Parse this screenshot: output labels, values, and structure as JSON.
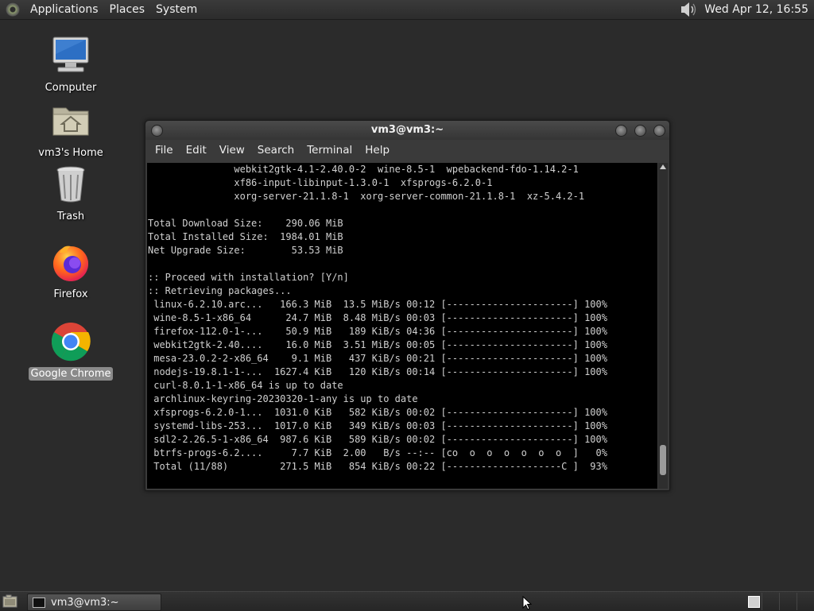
{
  "top_panel": {
    "menus": [
      "Applications",
      "Places",
      "System"
    ],
    "clock": "Wed Apr 12, 16:55"
  },
  "desktop_icons": [
    {
      "label": "Computer"
    },
    {
      "label": "vm3's Home"
    },
    {
      "label": "Trash"
    },
    {
      "label": "Firefox"
    },
    {
      "label": "Google Chrome"
    }
  ],
  "terminal": {
    "title": "vm3@vm3:~",
    "menus": [
      "File",
      "Edit",
      "View",
      "Search",
      "Terminal",
      "Help"
    ],
    "lines": [
      "               webkit2gtk-4.1-2.40.0-2  wine-8.5-1  wpebackend-fdo-1.14.2-1",
      "               xf86-input-libinput-1.3.0-1  xfsprogs-6.2.0-1",
      "               xorg-server-21.1.8-1  xorg-server-common-21.1.8-1  xz-5.4.2-1",
      "",
      "Total Download Size:    290.06 MiB",
      "Total Installed Size:  1984.01 MiB",
      "Net Upgrade Size:        53.53 MiB",
      "",
      ":: Proceed with installation? [Y/n]",
      ":: Retrieving packages...",
      " linux-6.2.10.arc...   166.3 MiB  13.5 MiB/s 00:12 [----------------------] 100%",
      " wine-8.5-1-x86_64      24.7 MiB  8.48 MiB/s 00:03 [----------------------] 100%",
      " firefox-112.0-1-...    50.9 MiB   189 KiB/s 04:36 [----------------------] 100%",
      " webkit2gtk-2.40....    16.0 MiB  3.51 MiB/s 00:05 [----------------------] 100%",
      " mesa-23.0.2-2-x86_64    9.1 MiB   437 KiB/s 00:21 [----------------------] 100%",
      " nodejs-19.8.1-1-...  1627.4 KiB   120 KiB/s 00:14 [----------------------] 100%",
      " curl-8.0.1-1-x86_64 is up to date",
      " archlinux-keyring-20230320-1-any is up to date",
      " xfsprogs-6.2.0-1...  1031.0 KiB   582 KiB/s 00:02 [----------------------] 100%",
      " systemd-libs-253...  1017.0 KiB   349 KiB/s 00:03 [----------------------] 100%",
      " sdl2-2.26.5-1-x86_64  987.6 KiB   589 KiB/s 00:02 [----------------------] 100%",
      " btrfs-progs-6.2....     7.7 KiB  2.00   B/s --:-- [co  o  o  o  o  o  o  ]   0%",
      " Total (11/88)         271.5 MiB   854 KiB/s 00:22 [--------------------C ]  93%"
    ]
  },
  "taskbar": {
    "task_label": "vm3@vm3:~"
  }
}
